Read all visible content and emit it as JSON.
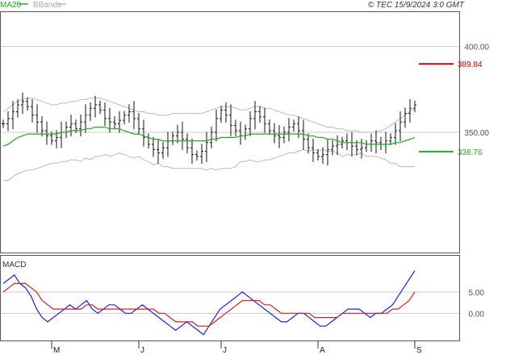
{
  "header": {
    "legend": [
      {
        "label": "MA20",
        "color": "#22aa22"
      },
      {
        "label": "BBands",
        "color": "#bbbbbb"
      }
    ],
    "copyright": "© TEC 15/9/2024 3:0 GMT"
  },
  "chart_data": [
    {
      "type": "candlestick",
      "title": "",
      "ylim": [
        280,
        420
      ],
      "yticks": [
        400,
        350
      ],
      "ytick_labels": [
        "400.00",
        "350.00"
      ],
      "month_ticks": [
        {
          "label": "M",
          "index": 10
        },
        {
          "label": "J",
          "index": 28
        },
        {
          "label": "J",
          "index": 45
        },
        {
          "label": "A",
          "index": 65
        },
        {
          "label": "S",
          "index": 85
        }
      ],
      "ohlc_close": [
        355,
        358,
        362,
        366,
        368,
        365,
        360,
        356,
        351,
        348,
        345,
        347,
        350,
        353,
        355,
        352,
        356,
        360,
        364,
        366,
        363,
        358,
        356,
        355,
        357,
        360,
        362,
        358,
        352,
        347,
        343,
        340,
        338,
        341,
        345,
        348,
        350,
        346,
        341,
        337,
        336,
        339,
        344,
        350,
        358,
        363,
        360,
        354,
        351,
        348,
        352,
        358,
        362,
        359,
        355,
        351,
        348,
        347,
        350,
        353,
        355,
        351,
        346,
        341,
        338,
        336,
        337,
        340,
        342,
        343,
        345,
        344,
        342,
        340,
        341,
        343,
        345,
        344,
        343,
        345,
        347,
        351,
        356,
        361,
        364,
        366
      ],
      "ma20": [
        342,
        343,
        345,
        347,
        348,
        349,
        349,
        349,
        349,
        349,
        349,
        349,
        350,
        350,
        351,
        351,
        351,
        352,
        352,
        353,
        353,
        353,
        352,
        352,
        352,
        351,
        350,
        349,
        349,
        348,
        347,
        346,
        346,
        345,
        345,
        345,
        345,
        345,
        345,
        345,
        345,
        345,
        345,
        346,
        346,
        347,
        347,
        347,
        347,
        348,
        348,
        349,
        349,
        349,
        349,
        349,
        349,
        349,
        349,
        349,
        349,
        349,
        349,
        348,
        348,
        347,
        347,
        346,
        346,
        345,
        344,
        344,
        344,
        344,
        344,
        343,
        343,
        343,
        343,
        343,
        343,
        344,
        344,
        345,
        346,
        347
      ],
      "bb_upper": [
        362,
        364,
        366,
        368,
        369,
        370,
        370,
        369,
        368,
        367,
        366,
        366,
        367,
        367,
        368,
        368,
        369,
        369,
        370,
        370,
        370,
        369,
        368,
        367,
        366,
        365,
        364,
        363,
        362,
        362,
        361,
        361,
        360,
        360,
        360,
        361,
        361,
        361,
        361,
        361,
        361,
        361,
        362,
        363,
        364,
        365,
        365,
        365,
        364,
        363,
        363,
        364,
        365,
        365,
        364,
        364,
        363,
        362,
        361,
        360,
        360,
        359,
        358,
        357,
        356,
        355,
        354,
        353,
        353,
        352,
        352,
        351,
        351,
        351,
        350,
        350,
        350,
        350,
        351,
        352,
        354,
        356,
        358,
        360,
        362,
        364
      ],
      "bb_lower": [
        322,
        322,
        324,
        326,
        327,
        328,
        328,
        329,
        330,
        331,
        332,
        332,
        333,
        333,
        334,
        334,
        333,
        335,
        334,
        336,
        336,
        337,
        336,
        337,
        338,
        337,
        336,
        335,
        336,
        334,
        333,
        331,
        332,
        330,
        330,
        329,
        329,
        329,
        329,
        329,
        329,
        329,
        328,
        329,
        328,
        329,
        329,
        329,
        330,
        333,
        333,
        334,
        333,
        333,
        334,
        334,
        335,
        336,
        337,
        338,
        338,
        339,
        340,
        339,
        340,
        339,
        340,
        339,
        339,
        338,
        336,
        337,
        337,
        337,
        338,
        336,
        336,
        336,
        335,
        334,
        332,
        332,
        330,
        330,
        330,
        330
      ],
      "last_close_marker": {
        "value": 389.84,
        "label": "389.84",
        "color": "#cc0000"
      },
      "ma_marker": {
        "value": 338.76,
        "label": "338.76",
        "color": "#22aa22"
      }
    },
    {
      "type": "line",
      "title": "MACD",
      "ylim": [
        -6,
        12
      ],
      "yticks": [
        5,
        0
      ],
      "ytick_labels": [
        "5.00",
        "0.00"
      ],
      "series": [
        {
          "name": "",
          "color": "#2222cc",
          "values": [
            7,
            8,
            9,
            7,
            6,
            4,
            1,
            -1,
            -2,
            -1,
            0,
            1,
            2,
            1,
            2,
            3,
            1,
            0,
            1,
            2,
            2,
            1,
            0,
            0,
            1,
            2,
            1,
            0,
            -1,
            -2,
            -3,
            -4,
            -3,
            -2,
            -3,
            -4,
            -5,
            -3,
            -1,
            1,
            2,
            3,
            4,
            5,
            4,
            3,
            2,
            1,
            0,
            -1,
            -2,
            -2,
            -1,
            0,
            0,
            -1,
            -2,
            -3,
            -3,
            -2,
            -1,
            0,
            1,
            1,
            1,
            0,
            -1,
            0,
            0,
            1,
            2,
            4,
            6,
            8,
            10
          ]
        },
        {
          "name": "",
          "color": "#cc2222",
          "values": [
            5,
            6,
            7,
            7,
            7,
            6,
            5,
            3,
            2,
            1,
            1,
            1,
            1,
            1,
            1,
            2,
            2,
            1,
            1,
            1,
            1,
            1,
            1,
            1,
            1,
            1,
            1,
            1,
            0,
            0,
            -1,
            -2,
            -2,
            -2,
            -2,
            -3,
            -3,
            -3,
            -2,
            -1,
            0,
            1,
            2,
            3,
            3,
            3,
            3,
            2,
            2,
            1,
            0,
            0,
            0,
            0,
            0,
            0,
            -1,
            -1,
            -1,
            -1,
            -1,
            0,
            0,
            0,
            0,
            0,
            0,
            0,
            0,
            0,
            1,
            1,
            2,
            3,
            5
          ]
        }
      ]
    }
  ]
}
